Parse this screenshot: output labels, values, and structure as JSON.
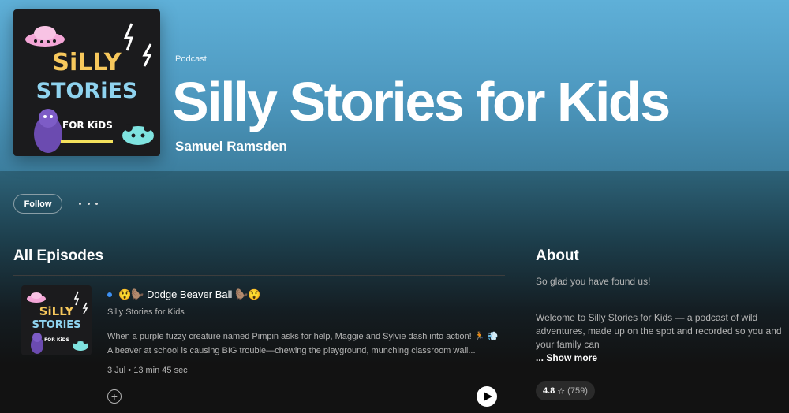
{
  "podcast": {
    "type_label": "Podcast",
    "title": "Silly Stories for Kids",
    "author": "Samuel Ramsden",
    "cover_text": {
      "line1": "SiLLY",
      "line2": "STORiES",
      "line3": "FOR KiDS"
    }
  },
  "actions": {
    "follow_label": "Follow",
    "more_icon": "more-horizontal-icon"
  },
  "episodes": {
    "heading": "All Episodes",
    "items": [
      {
        "title": "😲🦫 Dodge Beaver Ball 🦫😲",
        "show": "Silly Stories for Kids",
        "description": "When a purple fuzzy creature named Pimpin asks for help, Maggie and Sylvie dash into action! 🏃 💨A beaver at school is causing BIG trouble—chewing the playground, munching classroom wall...",
        "meta": "3 Jul • 13 min 45 sec",
        "is_new": true
      }
    ]
  },
  "about": {
    "heading": "About",
    "intro": "So glad you have found us!",
    "text": "Welcome to Silly Stories for Kids — a podcast of wild adventures, made up on the spot and recorded so you and your family can",
    "show_more": "... Show more",
    "rating_value": "4.8",
    "rating_star": "☆",
    "rating_count": "(759)"
  },
  "colors": {
    "hero": "#5fb0d8",
    "background": "#121212",
    "new_dot": "#3d91f4",
    "text_secondary": "#b3b3b3"
  }
}
